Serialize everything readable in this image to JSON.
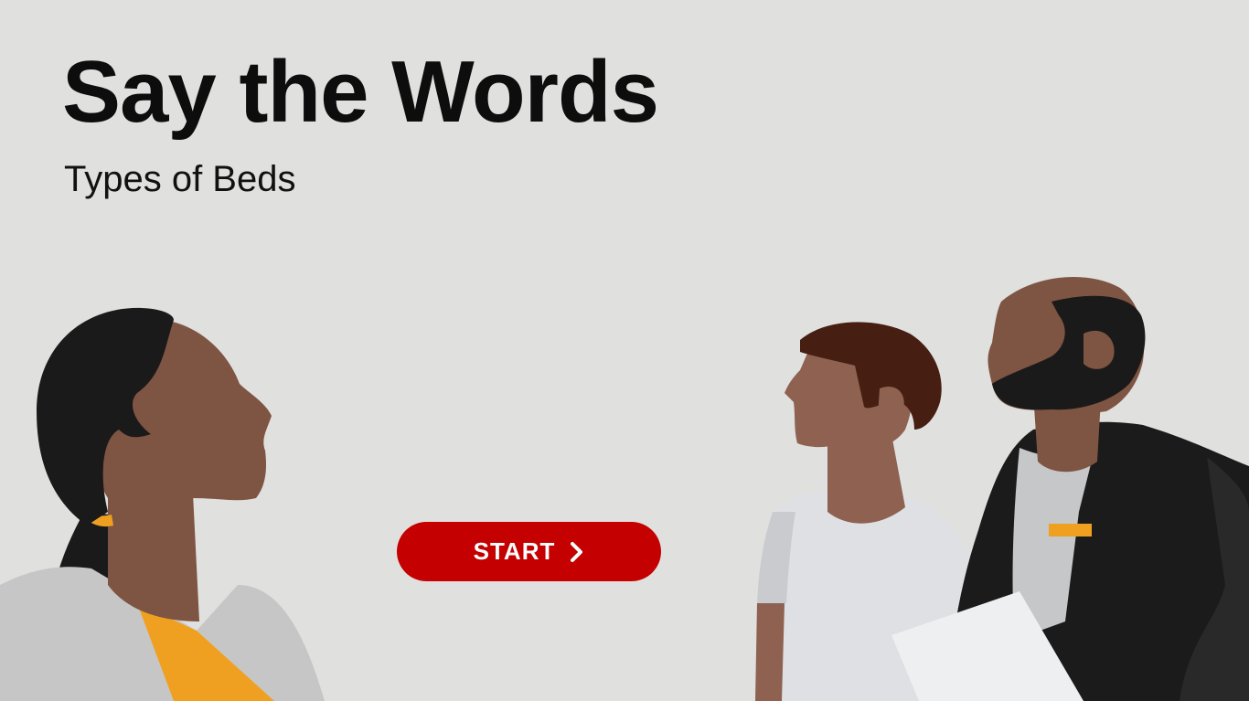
{
  "hero": {
    "title": "Say the Words",
    "subtitle": "Types of Beds"
  },
  "start_button": {
    "label": "START",
    "icon": "chevron-right-icon"
  },
  "colors": {
    "background": "#e0e0df",
    "accent": "#c40000",
    "skin_dark": "#7e5442",
    "skin_medium": "#8e6151",
    "hair_black": "#1b1a1a",
    "hair_brown": "#461e12",
    "shirt_white": "#dfe0e3",
    "jacket_black": "#1c1b1b",
    "collar_orange": "#f0a021"
  },
  "illustration": {
    "subject": "three-people-illustration"
  }
}
